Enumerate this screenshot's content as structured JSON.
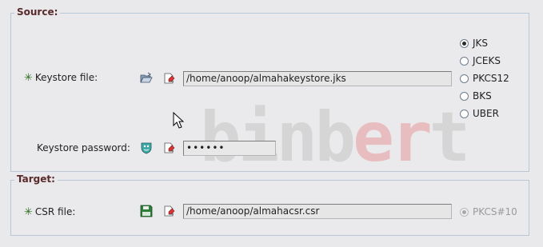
{
  "source": {
    "title": "Source:",
    "keystore_file_label": "Keystore file:",
    "keystore_file_value": "/home/anoop/almahakeystore.jks",
    "keystore_password_label": "Keystore password:",
    "keystore_password_value": "••••••",
    "types": [
      {
        "label": "JKS",
        "selected": true
      },
      {
        "label": "JCEKS",
        "selected": false
      },
      {
        "label": "PKCS12",
        "selected": false
      },
      {
        "label": "BKS",
        "selected": false
      },
      {
        "label": "UBER",
        "selected": false
      }
    ]
  },
  "target": {
    "title": "Target:",
    "csr_file_label": "CSR file:",
    "csr_file_value": "/home/anoop/almahacsr.csr",
    "format_label": "PKCS#10",
    "format_selected": true
  },
  "required_marker": "✳",
  "watermark": {
    "part1": "binb",
    "part2": "er",
    "part3": "t"
  },
  "icons": {
    "open_folder": "open-folder-icon",
    "clear": "clear-eraser-icon",
    "password": "password-mask-icon",
    "save": "save-disk-icon"
  },
  "colors": {
    "group_title": "#5a2a2a",
    "required": "#2c6e1c",
    "group_border": "#b9c8d8"
  }
}
